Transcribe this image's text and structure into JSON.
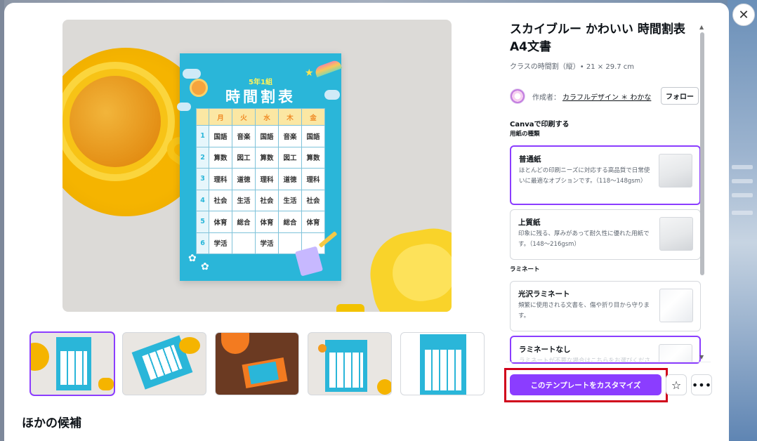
{
  "template": {
    "title": "スカイブルー かわいい 時間割表 A4文書",
    "meta": "クラスの時間割（縦）• 21 × 29.7 cm"
  },
  "creator": {
    "label": "作成者：",
    "name": "カラフルデザイン ＊ わかな",
    "follow_label": "フォロー"
  },
  "print": {
    "heading": "Canvaで印刷する",
    "paper_heading": "用紙の種類",
    "paper_options": [
      {
        "name": "普通紙",
        "desc": "ほとんどの印刷ニーズに対応する高品質で日常使いに最適なオプションです。（118〜148gsm）"
      },
      {
        "name": "上質紙",
        "desc": "印象に残る、厚みがあって耐久性に優れた用紙です。（148〜216gsm）"
      }
    ],
    "lamination_heading": "ラミネート",
    "lamination_options": [
      {
        "name": "光沢ラミネート",
        "desc": "頻繁に使用される文書を、傷や折り目から守ります。"
      },
      {
        "name": "ラミネートなし",
        "desc": "ラミネートが不要な場合はこちらをお選びください。"
      }
    ]
  },
  "actions": {
    "customize_label": "このテンプレートをカスタマイズ",
    "close_icon": "close-icon",
    "star_icon": "star-icon",
    "more_icon": "more-icon"
  },
  "poster": {
    "subtitle": "5年1組",
    "title": "時間割表",
    "days": [
      "月",
      "火",
      "水",
      "木",
      "金"
    ],
    "rows": [
      {
        "num": "1",
        "cells": [
          "国語",
          "音楽",
          "国語",
          "音楽",
          "国語"
        ]
      },
      {
        "num": "2",
        "cells": [
          "算数",
          "図工",
          "算数",
          "図工",
          "算数"
        ]
      },
      {
        "num": "3",
        "cells": [
          "理科",
          "道徳",
          "理科",
          "道徳",
          "理科"
        ]
      },
      {
        "num": "4",
        "cells": [
          "社会",
          "生活",
          "社会",
          "生活",
          "社会"
        ]
      },
      {
        "num": "5",
        "cells": [
          "体育",
          "総合",
          "体育",
          "総合",
          "体育"
        ]
      },
      {
        "num": "6",
        "cells": [
          "学活",
          "",
          "学活",
          "",
          ""
        ]
      }
    ]
  },
  "other_candidates_heading": "ほかの候補",
  "colors": {
    "accent": "#8b3dff",
    "highlight": "#d0021b",
    "poster": "#2ab6d9"
  }
}
